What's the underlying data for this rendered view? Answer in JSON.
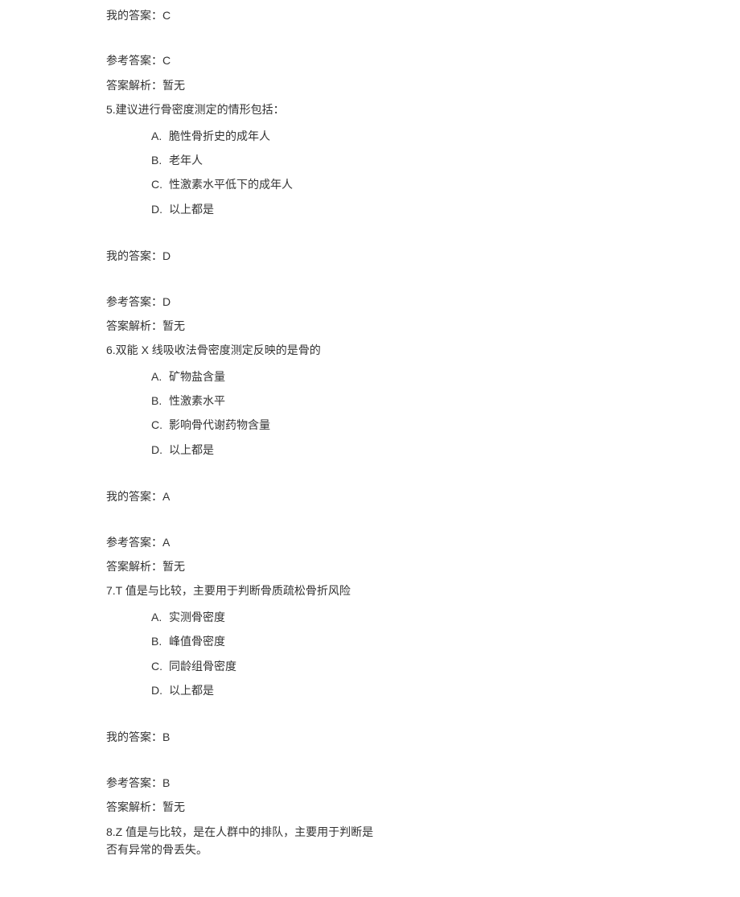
{
  "labels": {
    "my_answer": "我的答案：",
    "ref_answer": "参考答案：",
    "analysis": "答案解析：",
    "analysis_none": "暂无"
  },
  "questions": [
    {
      "prev_my_answer": "C",
      "prev_ref_answer": "C",
      "prev_analysis": "暂无",
      "number": "5",
      "stem": ".建议进行骨密度测定的情形包括：",
      "options": {
        "A": "脆性骨折史的成年人",
        "B": "老年人",
        "C": "性激素水平低下的成年人",
        "D": "以上都是"
      },
      "my_answer": "D",
      "ref_answer": "D",
      "analysis": "暂无"
    },
    {
      "number": "6",
      "stem": ".双能 X 线吸收法骨密度测定反映的是骨的",
      "options": {
        "A": "矿物盐含量",
        "B": "性激素水平",
        "C": "影响骨代谢药物含量",
        "D": "以上都是"
      },
      "my_answer": "A",
      "ref_answer": "A",
      "analysis": "暂无"
    },
    {
      "number": "7",
      "stem": ".T 值是与比较，主要用于判断骨质疏松骨折风险",
      "options": {
        "A": "实测骨密度",
        "B": "峰值骨密度",
        "C": "同龄组骨密度",
        "D": "以上都是"
      },
      "my_answer": "B",
      "ref_answer": "B",
      "analysis": "暂无"
    },
    {
      "number": "8",
      "stem": ".Z 值是与比较，是在人群中的排队，主要用于判断是否有异常的骨丢失。"
    }
  ]
}
